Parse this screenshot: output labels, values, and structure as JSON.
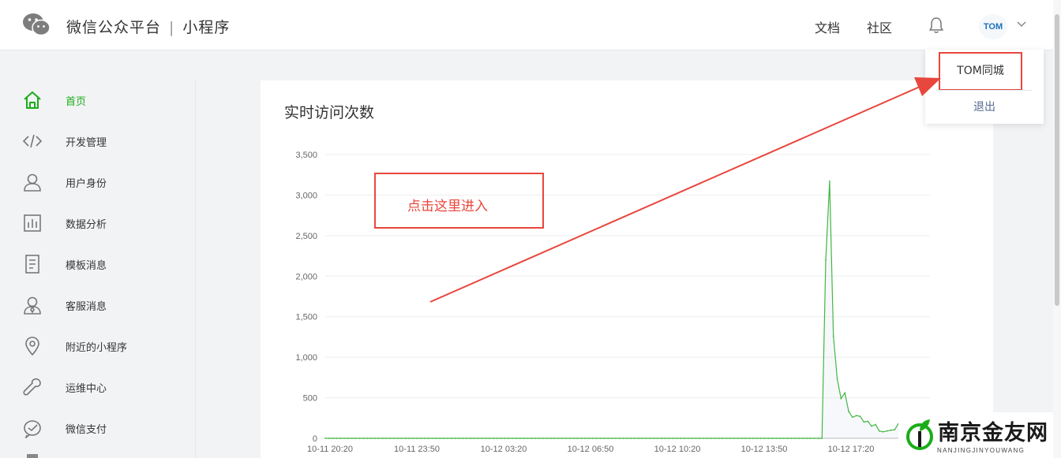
{
  "header": {
    "brand": "微信公众平台",
    "separator": "|",
    "product": "小程序",
    "links": [
      "文档",
      "社区"
    ],
    "avatar_text": "TOM"
  },
  "dropdown": {
    "username": "TOM同城",
    "logout": "退出"
  },
  "sidebar": {
    "items": [
      {
        "label": "首页",
        "icon": "home-icon",
        "active": true
      },
      {
        "label": "开发管理",
        "icon": "code-icon"
      },
      {
        "label": "用户身份",
        "icon": "user-icon"
      },
      {
        "label": "数据分析",
        "icon": "bar-chart-icon"
      },
      {
        "label": "模板消息",
        "icon": "document-icon"
      },
      {
        "label": "客服消息",
        "icon": "customer-service-icon"
      },
      {
        "label": "附近的小程序",
        "icon": "location-pin-icon"
      },
      {
        "label": "运维中心",
        "icon": "wrench-icon"
      },
      {
        "label": "微信支付",
        "icon": "payment-icon"
      }
    ]
  },
  "main": {
    "title": "实时访问次数"
  },
  "annotation": {
    "text": "点击这里进入"
  },
  "watermark": {
    "title": "南京金友网",
    "subtitle": "NANJINGJINYOUWANG"
  },
  "colors": {
    "accent": "#1aad19",
    "annotation": "#e8473d",
    "link": "#576b95"
  },
  "chart_data": {
    "type": "area",
    "title": "",
    "xlabel": "",
    "ylabel": "",
    "ylim": [
      0,
      3500
    ],
    "yticks": [
      0,
      500,
      1000,
      1500,
      2000,
      2500,
      3000,
      3500
    ],
    "ytick_labels": [
      "0",
      "500",
      "1,000",
      "1,500",
      "2,000",
      "2,500",
      "3,000",
      "3,500"
    ],
    "xtick_labels": [
      "10-11 20:20",
      "10-11 23:50",
      "10-12 03:20",
      "10-12 06:50",
      "10-12 10:20",
      "10-12 13:50",
      "10-12 17:20"
    ],
    "grid": true,
    "series": [
      {
        "values": [
          0,
          0,
          0,
          0,
          0,
          0,
          0,
          0,
          0,
          0,
          0,
          0,
          0,
          0,
          0,
          0,
          0,
          0,
          0,
          0,
          0,
          0,
          0,
          0,
          0,
          0,
          0,
          0,
          0,
          0,
          0,
          0,
          0,
          0,
          0,
          0,
          0,
          0,
          0,
          0,
          0,
          0,
          0,
          0,
          0,
          0,
          0,
          0,
          0,
          0,
          0,
          0,
          0,
          0,
          0,
          0,
          0,
          0,
          0,
          0,
          0,
          0,
          0,
          0,
          0,
          0,
          0,
          0,
          0,
          0,
          0,
          0,
          0,
          0,
          0,
          0,
          0,
          0,
          0,
          0,
          0,
          0,
          0,
          0,
          0,
          0,
          0,
          0,
          0,
          0,
          0,
          0,
          0,
          0,
          0,
          0,
          0,
          0,
          0,
          0,
          0,
          0,
          0,
          0,
          0,
          0,
          0,
          0,
          0,
          0,
          0,
          0,
          0,
          0,
          0,
          0,
          0,
          0,
          0,
          0,
          0,
          0,
          0,
          0,
          0,
          0,
          0,
          0,
          0,
          0,
          0,
          2200,
          3170,
          1260,
          730,
          490,
          560,
          330,
          260,
          280,
          270,
          200,
          210,
          150,
          170,
          90,
          80,
          90,
          100,
          105,
          180
        ]
      }
    ]
  }
}
